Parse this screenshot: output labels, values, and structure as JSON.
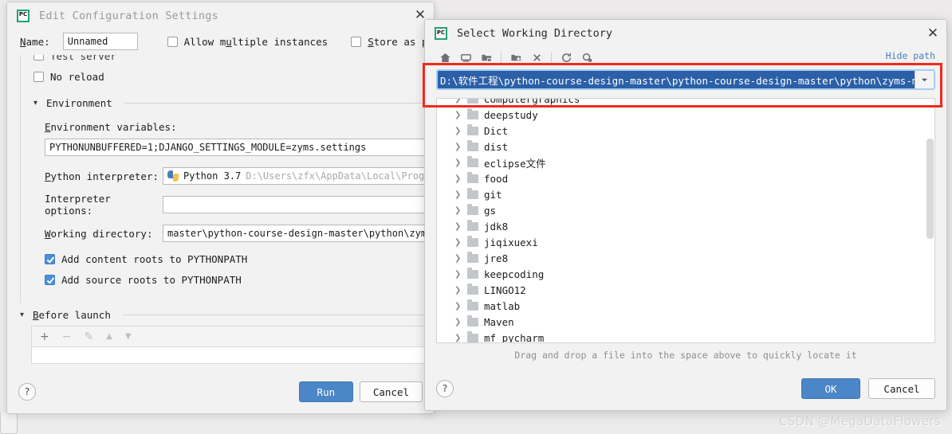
{
  "left_dialog": {
    "title": "Edit Configuration Settings",
    "logo_text": "PC",
    "close_icon": "close-icon",
    "name_label": "Name:",
    "name_value": "Unnamed",
    "allow_multiple_label": "Allow multiple instances",
    "store_as_label": "Store as pr",
    "test_server_label": "Test server",
    "no_reload_label": "No reload",
    "environment_section": "Environment",
    "env_vars_label": "Environment variables:",
    "env_vars_value": "PYTHONUNBUFFERED=1;DJANGO_SETTINGS_MODULE=zyms.settings",
    "python_interpreter_label": "Python interpreter:",
    "python_interpreter_value": "Python 3.7",
    "python_interpreter_path": "D:\\Users\\zfx\\AppData\\Local\\Progra",
    "interpreter_options_label": "Interpreter options:",
    "interpreter_options_value": "",
    "working_directory_label": "Working directory:",
    "working_directory_value": "master\\python-course-design-master\\python\\zyms-",
    "add_content_roots_label": "Add content roots to PYTHONPATH",
    "add_source_roots_label": "Add source roots to PYTHONPATH",
    "before_launch_section": "Before launch",
    "toolbar": {
      "add": "+",
      "remove": "−",
      "edit": "✎",
      "move_up": "▲",
      "move_down": "▼"
    },
    "help_label": "?",
    "run_button": "Run",
    "cancel_button": "Cancel"
  },
  "right_dialog": {
    "title": "Select Working Directory",
    "logo_text": "PC",
    "close_icon": "close-icon",
    "hide_path_link": "Hide path",
    "path_value": "D:\\软件工程\\python-course-design-master\\python-course-design-master\\python\\zyms-master",
    "toolbar_icons": [
      "home-icon",
      "desktop-icon",
      "project-folder-icon",
      "new-folder-icon",
      "delete-icon",
      "refresh-icon",
      "show-hidden-icon"
    ],
    "tree_items": [
      {
        "label": "Computergraphics"
      },
      {
        "label": "deepstudy"
      },
      {
        "label": "Dict"
      },
      {
        "label": "dist"
      },
      {
        "label": "eclipse文件"
      },
      {
        "label": "food"
      },
      {
        "label": "git"
      },
      {
        "label": "gs"
      },
      {
        "label": "jdk8"
      },
      {
        "label": "jiqixuexi"
      },
      {
        "label": "jre8"
      },
      {
        "label": "keepcoding"
      },
      {
        "label": "LINGO12"
      },
      {
        "label": "matlab"
      },
      {
        "label": "Maven"
      },
      {
        "label": "mf_pycharm"
      },
      {
        "label": ""
      }
    ],
    "hint": "Drag and drop a file into the space above to quickly locate it",
    "help_label": "?",
    "ok_button": "OK",
    "cancel_button": "Cancel"
  },
  "annotation": {
    "color": "#f22a1c",
    "name": "path-highlight-box"
  },
  "watermark": "CSDN @MegaDataFlowers"
}
